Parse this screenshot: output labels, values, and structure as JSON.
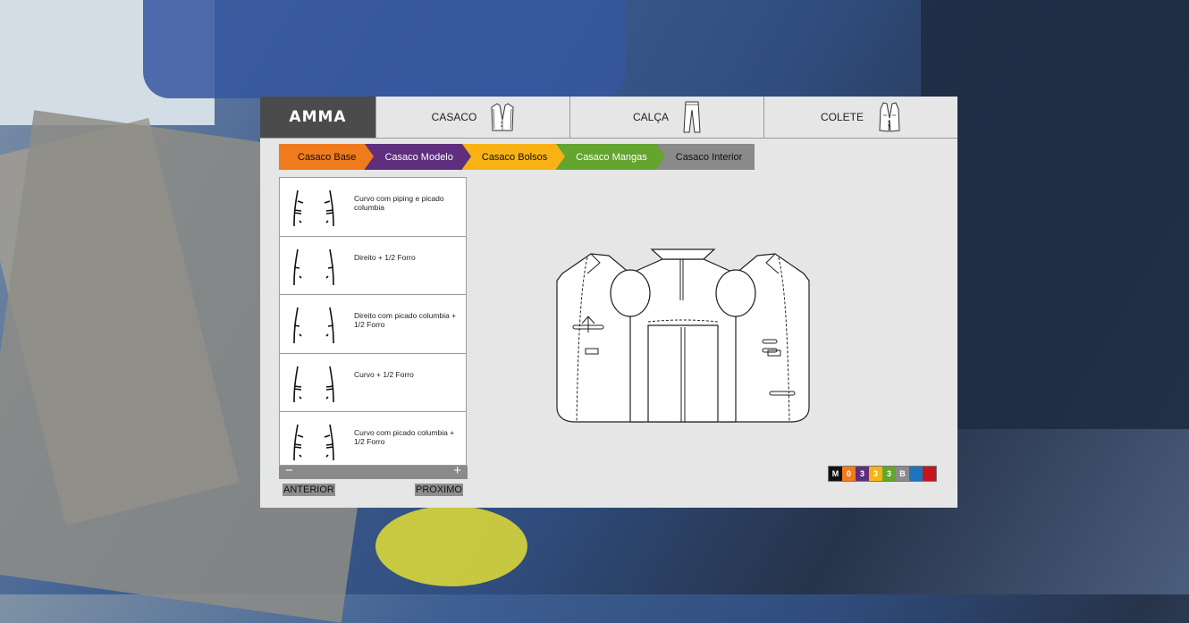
{
  "logo": {
    "text": "AMMA"
  },
  "nav": [
    {
      "label": "CASACO",
      "icon": "jacket-icon"
    },
    {
      "label": "CALÇA",
      "icon": "trousers-icon"
    },
    {
      "label": "COLETE",
      "icon": "vest-icon"
    }
  ],
  "steps": [
    {
      "label": "Casaco Base",
      "color": "#f07b1c"
    },
    {
      "label": "Casaco Modelo",
      "color": "#5f2f7e"
    },
    {
      "label": "Casaco Bolsos",
      "color": "#f8b214"
    },
    {
      "label": "Casaco Mangas",
      "color": "#63a52f"
    },
    {
      "label": "Casaco Interior",
      "color": "#8a8a8a"
    }
  ],
  "options": [
    {
      "label": "Curvo com piping e picado columbia"
    },
    {
      "label": "Direito + 1/2 Forro"
    },
    {
      "label": "Direito com picado columbia + 1/2 Forro"
    },
    {
      "label": "Curvo + 1/2 Forro"
    },
    {
      "label": "Curvo com picado columbia + 1/2 Forro"
    }
  ],
  "scroll": {
    "minus": "−",
    "plus": "+"
  },
  "buttons": {
    "prev": "ANTERIOR",
    "next": "PROXIMO"
  },
  "swatches": [
    {
      "text": "M",
      "color": "#111111"
    },
    {
      "text": "0",
      "color": "#f07b1c"
    },
    {
      "text": "3",
      "color": "#5f2f7e"
    },
    {
      "text": "3",
      "color": "#f8b214"
    },
    {
      "text": "3",
      "color": "#63a52f"
    },
    {
      "text": "B",
      "color": "#8a8a8a"
    },
    {
      "text": "",
      "color": "#1e73be"
    },
    {
      "text": "",
      "color": "#c4161c"
    }
  ]
}
